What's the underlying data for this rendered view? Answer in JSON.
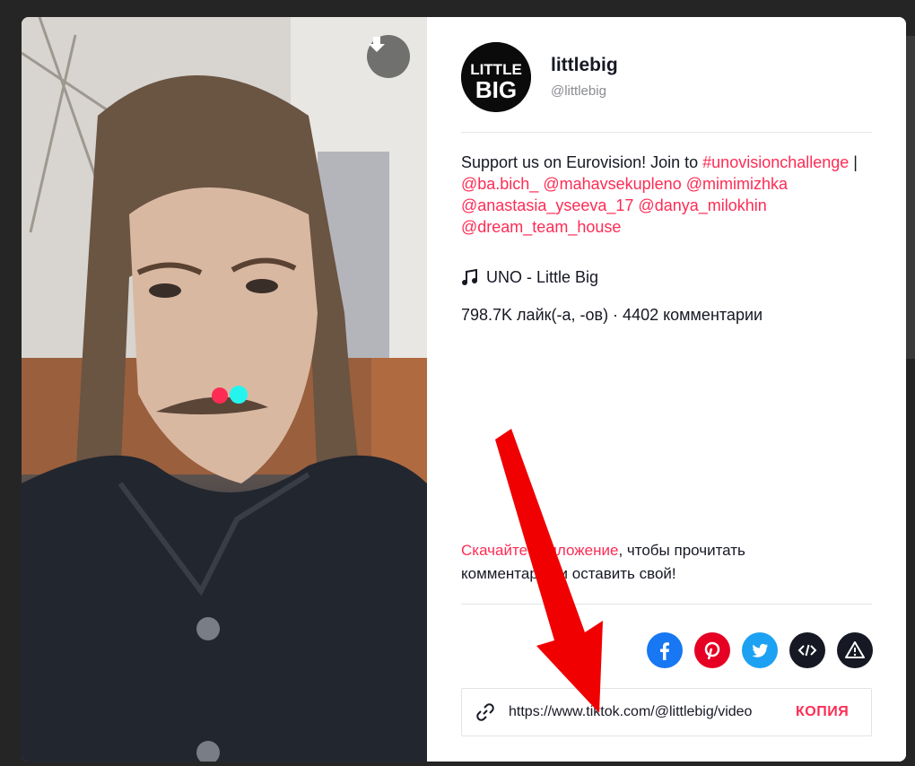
{
  "author": {
    "username": "littlebig",
    "handle": "@littlebig",
    "avatar_text_top": "LITTLE",
    "avatar_text_bottom": "BIG"
  },
  "description": {
    "text": "Support us on Eurovision! Join to ",
    "tags": [
      "#unovisionchallenge",
      "@ba.bich_",
      "@mahavsekupleno",
      "@mimimizhka",
      "@anastasia_yseeva_17",
      "@danya_milokhin",
      "@dream_team_house"
    ],
    "separator": " | "
  },
  "music": {
    "icon": "music-note-icon",
    "title": "UNO - Little Big"
  },
  "stats": {
    "text": "798.7K лайк(-а, -ов) · 4402 комментарии"
  },
  "download_prompt": {
    "link": "Скачайте приложение",
    "rest": ", чтобы прочитать комментарии и оставить свой!"
  },
  "share": [
    {
      "name": "facebook",
      "icon": "facebook-icon",
      "color": "#1877f2"
    },
    {
      "name": "pinterest",
      "icon": "pinterest-icon",
      "color": "#e60023"
    },
    {
      "name": "twitter",
      "icon": "twitter-icon",
      "color": "#1da1f2"
    },
    {
      "name": "embed",
      "icon": "embed-icon",
      "color": "#161823"
    },
    {
      "name": "report",
      "icon": "warning-icon",
      "color": "#161823"
    }
  ],
  "share_link": {
    "url": "https://www.tiktok.com/@littlebig/video",
    "copy_label": "КОПИЯ"
  },
  "colors": {
    "accent": "#fe2c55",
    "annotation_arrow": "#f00000"
  }
}
